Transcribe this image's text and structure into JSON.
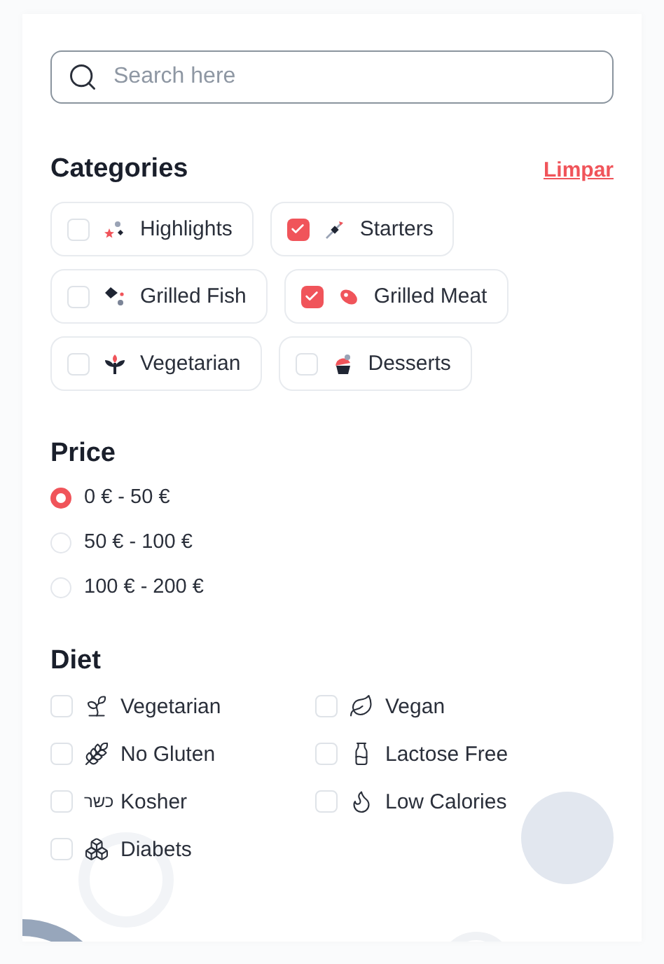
{
  "search": {
    "placeholder": "Search here"
  },
  "categories": {
    "title": "Categories",
    "clear_link": "Limpar",
    "rows": [
      [
        {
          "label": "Highlights",
          "checked": false,
          "kind": "highlights"
        },
        {
          "label": "Starters",
          "checked": true,
          "kind": "starters"
        }
      ],
      [
        {
          "label": "Grilled Fish",
          "checked": false,
          "kind": "fish"
        },
        {
          "label": "Grilled Meat",
          "checked": true,
          "kind": "meat"
        }
      ],
      [
        {
          "label": "Vegetarian",
          "checked": false,
          "kind": "vegetarian"
        },
        {
          "label": "Desserts",
          "checked": false,
          "kind": "desserts"
        }
      ]
    ]
  },
  "price": {
    "title": "Price",
    "options": [
      {
        "label": "0 € - 50 €",
        "selected": true
      },
      {
        "label": "50 € - 100 €",
        "selected": false
      },
      {
        "label": "100 € - 200 €",
        "selected": false
      }
    ]
  },
  "diet": {
    "title": "Diet",
    "options": [
      {
        "label": "Vegetarian",
        "checked": false,
        "kind": "sprout"
      },
      {
        "label": "Vegan",
        "checked": false,
        "kind": "leaf"
      },
      {
        "label": "No Gluten",
        "checked": false,
        "kind": "wheat"
      },
      {
        "label": "Lactose Free",
        "checked": false,
        "kind": "milk"
      },
      {
        "label": "Kosher",
        "checked": false,
        "kind": "text",
        "icon_text": "כשר"
      },
      {
        "label": "Low Calories",
        "checked": false,
        "kind": "flame"
      },
      {
        "label": "Diabets",
        "checked": false,
        "kind": "boxes"
      }
    ]
  }
}
